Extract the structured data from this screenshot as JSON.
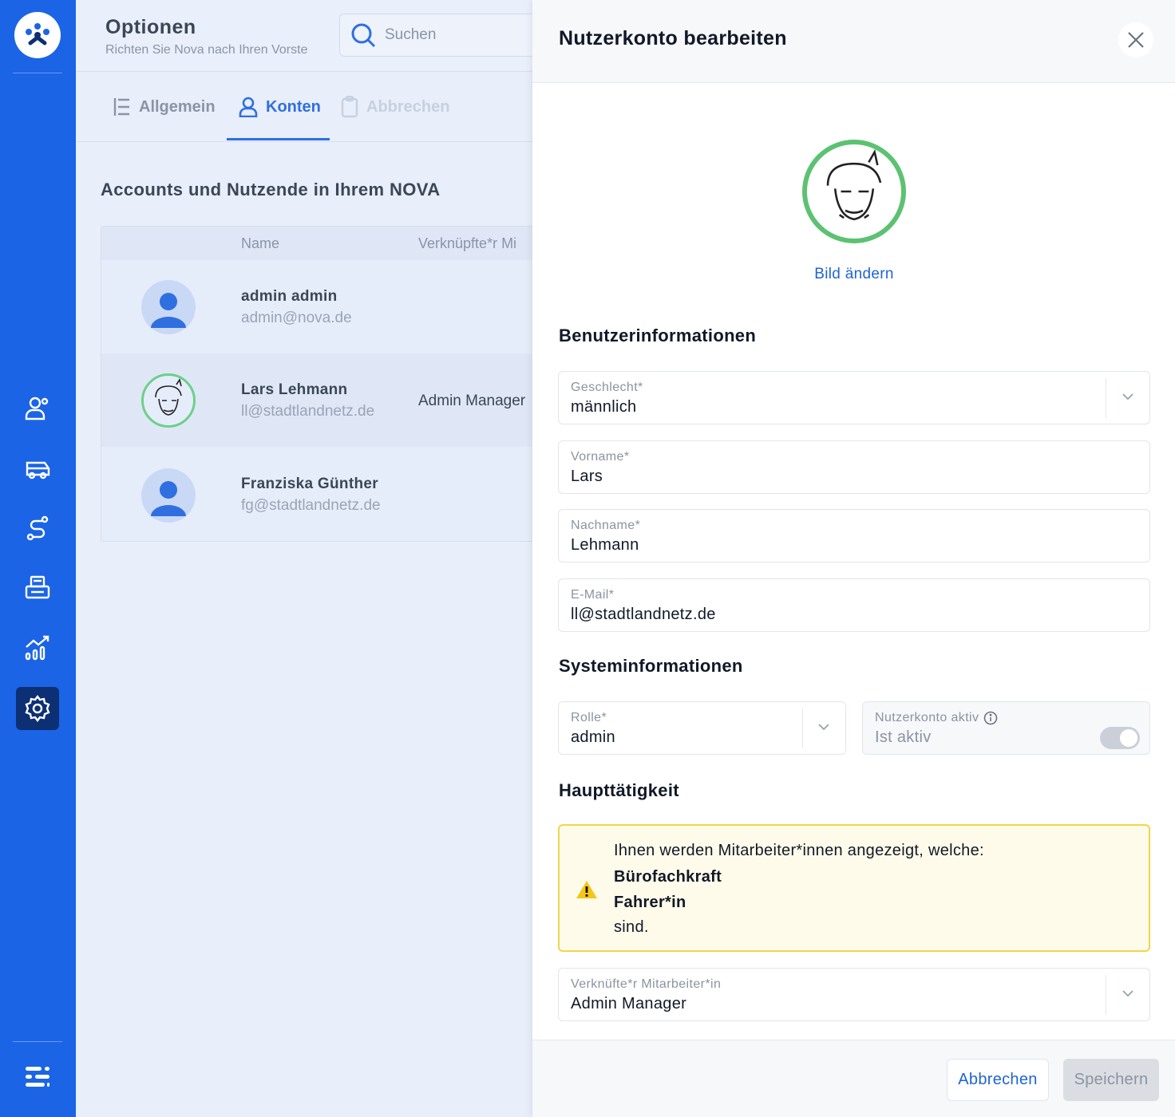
{
  "app": {
    "title": "Optionen",
    "subtitle": "Richten Sie Nova nach Ihren Vorste",
    "search_placeholder": "Suchen"
  },
  "tabs": [
    {
      "label": "Allgemein",
      "icon": "list-icon",
      "active": false
    },
    {
      "label": "Konten",
      "icon": "user-icon",
      "active": true
    },
    {
      "label": "Abbrechen",
      "icon": "clipboard-icon",
      "active": false
    }
  ],
  "accounts": {
    "section_title": "Accounts und Nutzende in Ihrem NOVA",
    "columns": [
      "Name",
      "Verknüpfte*r Mi"
    ],
    "rows": [
      {
        "name": "admin admin",
        "email": "admin@nova.de",
        "linked": "",
        "avatar": "default-avatar-icon"
      },
      {
        "name": "Lars Lehmann",
        "email": "ll@stadtlandnetz.de",
        "linked": "Admin Manager",
        "avatar": "illustrated-avatar-icon"
      },
      {
        "name": "Franziska Günther",
        "email": "fg@stadtlandnetz.de",
        "linked": "",
        "avatar": "default-avatar-icon"
      }
    ]
  },
  "sidebar": {
    "items": [
      {
        "icon": "users-icon",
        "active": false
      },
      {
        "icon": "bus-icon",
        "active": false
      },
      {
        "icon": "route-icon",
        "active": false
      },
      {
        "icon": "printer-icon",
        "active": false
      },
      {
        "icon": "statistics-icon",
        "active": false
      },
      {
        "icon": "gear-icon",
        "active": true
      }
    ],
    "bottom_icon": "sliders-icon"
  },
  "modal": {
    "title": "Nutzerkonto bearbeiten",
    "change_picture": "Bild ändern",
    "user_info_title": "Benutzerinformationen",
    "gender": {
      "label": "Geschlecht*",
      "value": "männlich"
    },
    "firstname": {
      "label": "Vorname*",
      "value": "Lars"
    },
    "lastname": {
      "label": "Nachname*",
      "value": "Lehmann"
    },
    "email": {
      "label": "E-Mail*",
      "value": "ll@stadtlandnetz.de"
    },
    "system_info_title": "Systeminformationen",
    "role": {
      "label": "Rolle*",
      "value": "admin"
    },
    "active": {
      "label": "Nutzerkonto aktiv",
      "value": "Ist aktiv",
      "on": true
    },
    "main_activity_title": "Haupttätigkeit",
    "alert": {
      "intro": "Ihnen werden Mitarbeiter*innen angezeigt, welche:",
      "items": [
        "Bürofachkraft",
        "Fahrer*in"
      ],
      "outro": "sind."
    },
    "linked_employee": {
      "label": "Verknüfte*r Mitarbeiter*in",
      "value": "Admin Manager"
    },
    "cancel_label": "Abbrechen",
    "save_label": "Speichern"
  },
  "colors": {
    "sidebar": "#1b64e6",
    "accent": "#1f63d6",
    "avatar_ring": "#5cc272",
    "alert_border": "#f2d44b"
  }
}
